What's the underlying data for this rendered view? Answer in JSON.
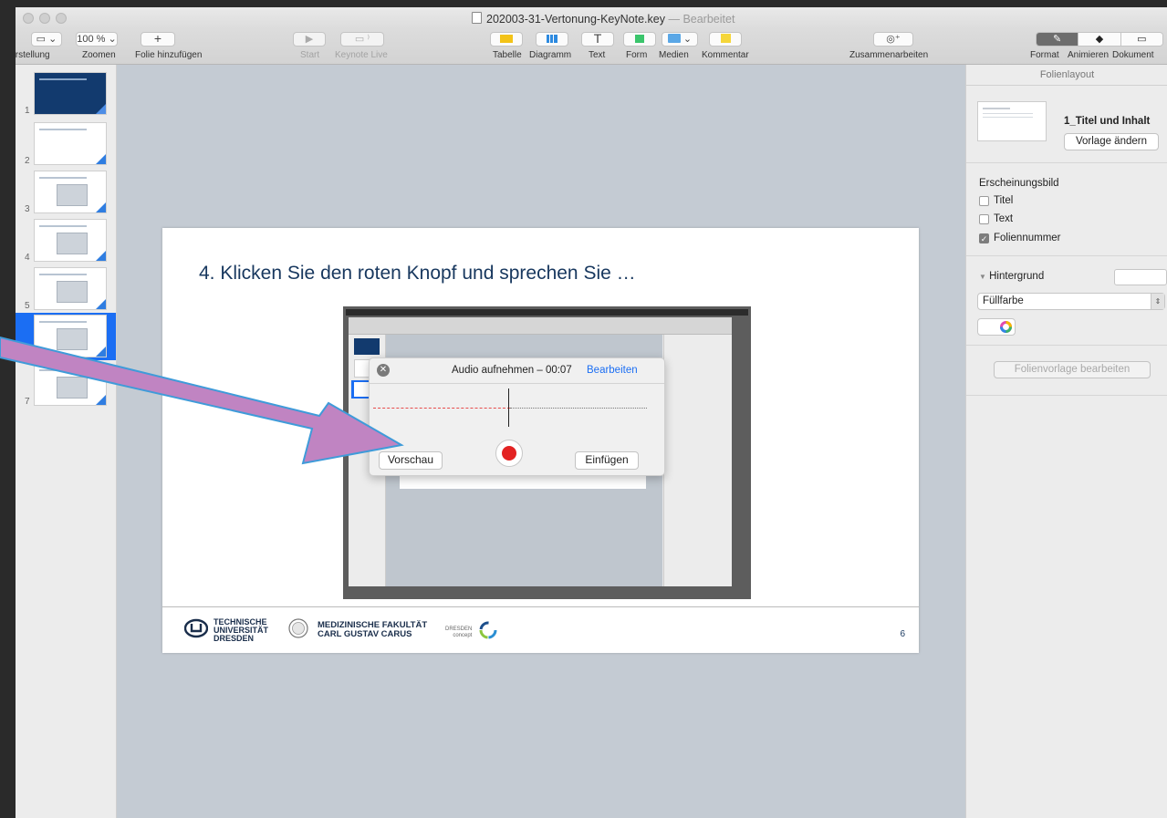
{
  "window": {
    "title": "202003-31-Vertonung-KeyNote.key",
    "title_sep": "—",
    "title_state": "Bearbeitet"
  },
  "toolbar": {
    "zoom_value": "100 %",
    "labels": {
      "view": "Darstellung",
      "zoom": "Zoomen",
      "add_slide": "Folie hinzufügen",
      "play": "Start",
      "keynote_live": "Keynote Live",
      "table": "Tabelle",
      "chart": "Diagramm",
      "text": "Text",
      "shape": "Form",
      "media": "Medien",
      "comment": "Kommentar",
      "collaborate": "Zusammenarbeiten",
      "format": "Format",
      "animate": "Animieren",
      "document": "Dokument"
    }
  },
  "sidebar": {
    "slides": [
      "1",
      "2",
      "3",
      "4",
      "5",
      "6",
      "7"
    ],
    "selected": "6"
  },
  "slide": {
    "title": "4. Klicken Sie den roten Knopf und sprechen Sie …",
    "page_number": "6",
    "logos": {
      "tu": [
        "TECHNISCHE",
        "UNIVERSITÄT",
        "DRESDEN"
      ],
      "med": [
        "MEDIZINISCHE FAKULTÄT",
        "CARL GUSTAV CARUS"
      ],
      "dc": [
        "DRESDEN",
        "concept"
      ]
    }
  },
  "inspector": {
    "header": "Folienlayout",
    "layout_name": "1_Titel und Inhalt",
    "change_master": "Vorlage ändern",
    "appearance_label": "Erscheinungsbild",
    "appearance_items": [
      {
        "label": "Titel",
        "checked": false
      },
      {
        "label": "Text",
        "checked": false
      },
      {
        "label": "Foliennummer",
        "checked": true
      }
    ],
    "background_label": "Hintergrund",
    "fill_option": "Füllfarbe",
    "edit_master": "Folienvorlage bearbeiten"
  },
  "dialog": {
    "title": "Audio aufnehmen – 00:07",
    "edit": "Bearbeiten",
    "preview": "Vorschau",
    "insert": "Einfügen"
  },
  "colors": {
    "accent": "#1b6ef3",
    "record": "#e32222",
    "arrow": "#c084c2",
    "slide_title": "#17375e"
  }
}
